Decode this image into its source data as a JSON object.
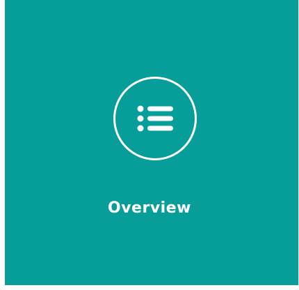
{
  "tile": {
    "label": "Overview",
    "icon": "list-icon",
    "background_color": "#079e9a",
    "foreground_color": "#ffffff"
  }
}
